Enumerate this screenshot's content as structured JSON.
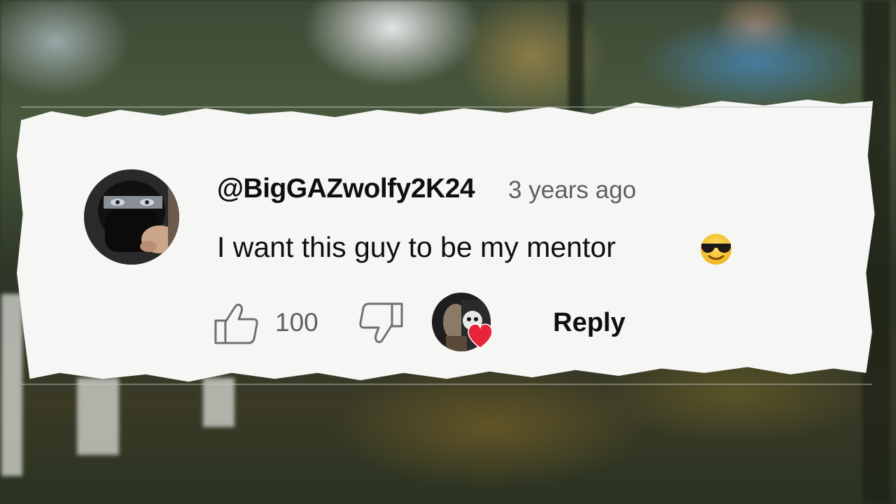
{
  "comment": {
    "username": "@BigGAZwolfy2K24",
    "timestamp": "3 years ago",
    "text": "I want this guy to be my mentor",
    "emoji_name": "smiling-face-with-sunglasses-icon"
  },
  "actions": {
    "like_count": "100",
    "reply_label": "Reply"
  },
  "colors": {
    "text_primary": "#0f0f0f",
    "text_secondary": "#606060",
    "heart": "#e8233a",
    "paper": "#f6f6f5"
  }
}
